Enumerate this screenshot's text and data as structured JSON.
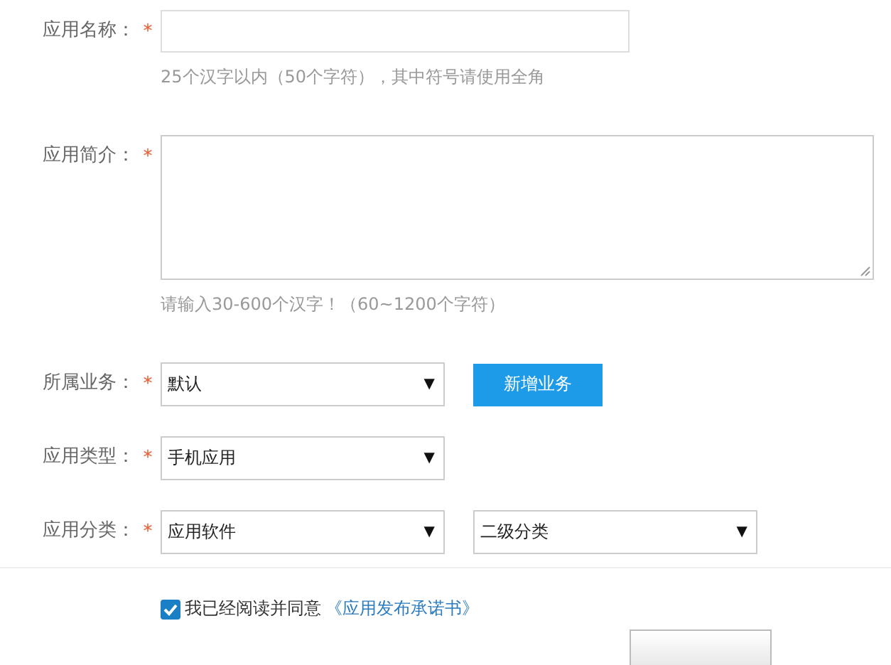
{
  "fields": [
    {
      "kind": "input",
      "label": "应用名称：",
      "required_mark": "*",
      "hint": "25个汉字以内（50个字符），其中符号请使用全角"
    },
    {
      "kind": "textarea",
      "label": "应用简介：",
      "required_mark": "*",
      "hint": "请输入30-600个汉字！（60~1200个字符）"
    },
    {
      "kind": "select",
      "label": "所属业务：",
      "required_mark": "*",
      "selects": [
        {
          "value": "默认",
          "arrow": "▼"
        }
      ],
      "button": "新增业务"
    },
    {
      "kind": "select",
      "label": "应用类型：",
      "required_mark": "*",
      "selects": [
        {
          "value": "手机应用",
          "arrow": "▼"
        }
      ]
    },
    {
      "kind": "select",
      "label": "应用分类：",
      "required_mark": "*",
      "selects": [
        {
          "value": "应用软件",
          "arrow": "▼"
        },
        {
          "value": "二级分类",
          "arrow": "▼"
        }
      ]
    }
  ],
  "agreement": {
    "checked": true,
    "text": "我已经阅读并同意",
    "link": "《应用发布承诺书》"
  }
}
